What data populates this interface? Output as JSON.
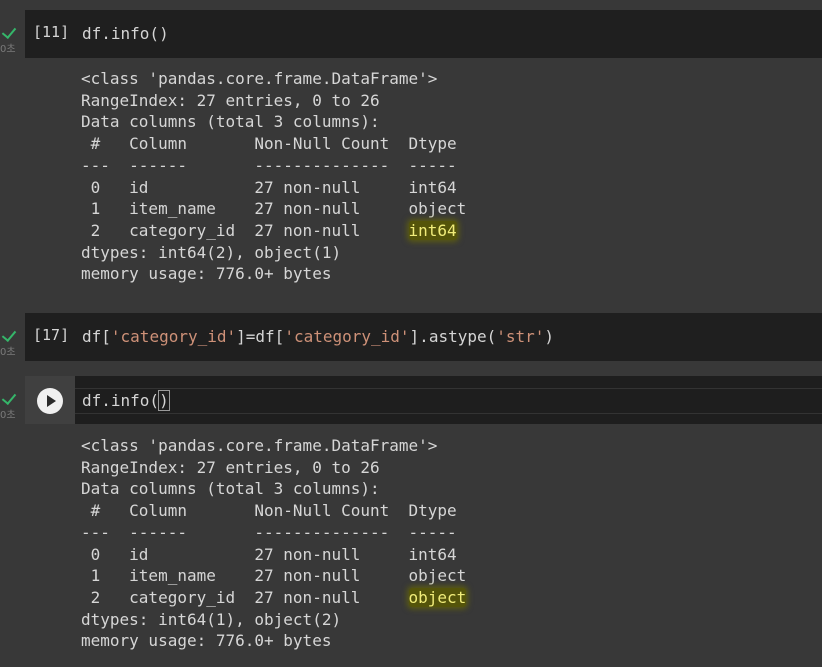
{
  "cells": [
    {
      "exec_count": "[11]",
      "exec_time": "0초",
      "code_tokens": [
        {
          "text": "df.info()",
          "type": "plain"
        }
      ],
      "output": {
        "lines": [
          "<class 'pandas.core.frame.DataFrame'>",
          "RangeIndex: 27 entries, 0 to 26",
          "Data columns (total 3 columns):",
          " #   Column       Non-Null Count  Dtype ",
          "---  ------       --------------  ----- "
        ],
        "rows": [
          {
            "prefix": " 0   id           27 non-null     ",
            "dtype": "int64",
            "highlight": false
          },
          {
            "prefix": " 1   item_name    27 non-null     ",
            "dtype": "object",
            "highlight": false
          },
          {
            "prefix": " 2   category_id  27 non-null     ",
            "dtype": "int64",
            "highlight": true
          }
        ],
        "footer": [
          "dtypes: int64(2), object(1)",
          "memory usage: 776.0+ bytes"
        ]
      }
    },
    {
      "exec_count": "[17]",
      "exec_time": "0초",
      "code_tokens": [
        {
          "text": "df[",
          "type": "plain"
        },
        {
          "text": "'category_id'",
          "type": "str"
        },
        {
          "text": "]=df[",
          "type": "plain"
        },
        {
          "text": "'category_id'",
          "type": "str"
        },
        {
          "text": "].astype(",
          "type": "plain"
        },
        {
          "text": "'str'",
          "type": "str"
        },
        {
          "text": ")",
          "type": "plain"
        }
      ]
    },
    {
      "exec_time": "0초",
      "code_before_cursor": "df.info(",
      "code_after_cursor": ")",
      "output": {
        "lines": [
          "<class 'pandas.core.frame.DataFrame'>",
          "RangeIndex: 27 entries, 0 to 26",
          "Data columns (total 3 columns):",
          " #   Column       Non-Null Count  Dtype ",
          "---  ------       --------------  ----- "
        ],
        "rows": [
          {
            "prefix": " 0   id           27 non-null     ",
            "dtype": "int64",
            "highlight": false
          },
          {
            "prefix": " 1   item_name    27 non-null     ",
            "dtype": "object",
            "highlight": false
          },
          {
            "prefix": " 2   category_id  27 non-null     ",
            "dtype": "object",
            "highlight": true
          }
        ],
        "footer": [
          "dtypes: int64(1), object(2)",
          "memory usage: 776.0+ bytes"
        ]
      }
    }
  ],
  "colors": {
    "background": "#383838",
    "code_background": "#1f1f1f",
    "success_check": "#35b66a",
    "string_token": "#ce9178",
    "highlight": "#f0ec7a"
  },
  "icons": [
    "check-icon",
    "play-icon"
  ]
}
